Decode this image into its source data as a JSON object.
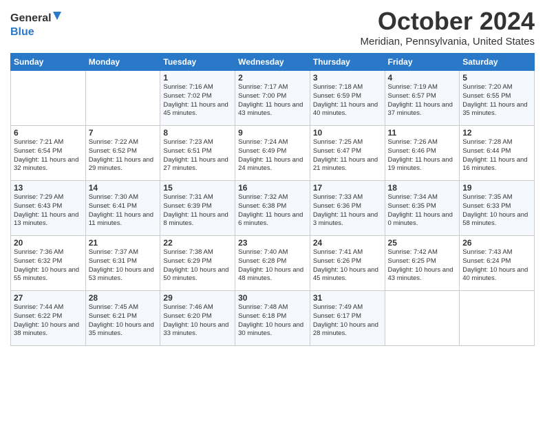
{
  "header": {
    "logo_line1": "General",
    "logo_line2": "Blue",
    "month": "October 2024",
    "location": "Meridian, Pennsylvania, United States"
  },
  "weekdays": [
    "Sunday",
    "Monday",
    "Tuesday",
    "Wednesday",
    "Thursday",
    "Friday",
    "Saturday"
  ],
  "weeks": [
    [
      {
        "day": "",
        "sunrise": "",
        "sunset": "",
        "daylight": ""
      },
      {
        "day": "",
        "sunrise": "",
        "sunset": "",
        "daylight": ""
      },
      {
        "day": "1",
        "sunrise": "Sunrise: 7:16 AM",
        "sunset": "Sunset: 7:02 PM",
        "daylight": "Daylight: 11 hours and 45 minutes."
      },
      {
        "day": "2",
        "sunrise": "Sunrise: 7:17 AM",
        "sunset": "Sunset: 7:00 PM",
        "daylight": "Daylight: 11 hours and 43 minutes."
      },
      {
        "day": "3",
        "sunrise": "Sunrise: 7:18 AM",
        "sunset": "Sunset: 6:59 PM",
        "daylight": "Daylight: 11 hours and 40 minutes."
      },
      {
        "day": "4",
        "sunrise": "Sunrise: 7:19 AM",
        "sunset": "Sunset: 6:57 PM",
        "daylight": "Daylight: 11 hours and 37 minutes."
      },
      {
        "day": "5",
        "sunrise": "Sunrise: 7:20 AM",
        "sunset": "Sunset: 6:55 PM",
        "daylight": "Daylight: 11 hours and 35 minutes."
      }
    ],
    [
      {
        "day": "6",
        "sunrise": "Sunrise: 7:21 AM",
        "sunset": "Sunset: 6:54 PM",
        "daylight": "Daylight: 11 hours and 32 minutes."
      },
      {
        "day": "7",
        "sunrise": "Sunrise: 7:22 AM",
        "sunset": "Sunset: 6:52 PM",
        "daylight": "Daylight: 11 hours and 29 minutes."
      },
      {
        "day": "8",
        "sunrise": "Sunrise: 7:23 AM",
        "sunset": "Sunset: 6:51 PM",
        "daylight": "Daylight: 11 hours and 27 minutes."
      },
      {
        "day": "9",
        "sunrise": "Sunrise: 7:24 AM",
        "sunset": "Sunset: 6:49 PM",
        "daylight": "Daylight: 11 hours and 24 minutes."
      },
      {
        "day": "10",
        "sunrise": "Sunrise: 7:25 AM",
        "sunset": "Sunset: 6:47 PM",
        "daylight": "Daylight: 11 hours and 21 minutes."
      },
      {
        "day": "11",
        "sunrise": "Sunrise: 7:26 AM",
        "sunset": "Sunset: 6:46 PM",
        "daylight": "Daylight: 11 hours and 19 minutes."
      },
      {
        "day": "12",
        "sunrise": "Sunrise: 7:28 AM",
        "sunset": "Sunset: 6:44 PM",
        "daylight": "Daylight: 11 hours and 16 minutes."
      }
    ],
    [
      {
        "day": "13",
        "sunrise": "Sunrise: 7:29 AM",
        "sunset": "Sunset: 6:43 PM",
        "daylight": "Daylight: 11 hours and 13 minutes."
      },
      {
        "day": "14",
        "sunrise": "Sunrise: 7:30 AM",
        "sunset": "Sunset: 6:41 PM",
        "daylight": "Daylight: 11 hours and 11 minutes."
      },
      {
        "day": "15",
        "sunrise": "Sunrise: 7:31 AM",
        "sunset": "Sunset: 6:39 PM",
        "daylight": "Daylight: 11 hours and 8 minutes."
      },
      {
        "day": "16",
        "sunrise": "Sunrise: 7:32 AM",
        "sunset": "Sunset: 6:38 PM",
        "daylight": "Daylight: 11 hours and 6 minutes."
      },
      {
        "day": "17",
        "sunrise": "Sunrise: 7:33 AM",
        "sunset": "Sunset: 6:36 PM",
        "daylight": "Daylight: 11 hours and 3 minutes."
      },
      {
        "day": "18",
        "sunrise": "Sunrise: 7:34 AM",
        "sunset": "Sunset: 6:35 PM",
        "daylight": "Daylight: 11 hours and 0 minutes."
      },
      {
        "day": "19",
        "sunrise": "Sunrise: 7:35 AM",
        "sunset": "Sunset: 6:33 PM",
        "daylight": "Daylight: 10 hours and 58 minutes."
      }
    ],
    [
      {
        "day": "20",
        "sunrise": "Sunrise: 7:36 AM",
        "sunset": "Sunset: 6:32 PM",
        "daylight": "Daylight: 10 hours and 55 minutes."
      },
      {
        "day": "21",
        "sunrise": "Sunrise: 7:37 AM",
        "sunset": "Sunset: 6:31 PM",
        "daylight": "Daylight: 10 hours and 53 minutes."
      },
      {
        "day": "22",
        "sunrise": "Sunrise: 7:38 AM",
        "sunset": "Sunset: 6:29 PM",
        "daylight": "Daylight: 10 hours and 50 minutes."
      },
      {
        "day": "23",
        "sunrise": "Sunrise: 7:40 AM",
        "sunset": "Sunset: 6:28 PM",
        "daylight": "Daylight: 10 hours and 48 minutes."
      },
      {
        "day": "24",
        "sunrise": "Sunrise: 7:41 AM",
        "sunset": "Sunset: 6:26 PM",
        "daylight": "Daylight: 10 hours and 45 minutes."
      },
      {
        "day": "25",
        "sunrise": "Sunrise: 7:42 AM",
        "sunset": "Sunset: 6:25 PM",
        "daylight": "Daylight: 10 hours and 43 minutes."
      },
      {
        "day": "26",
        "sunrise": "Sunrise: 7:43 AM",
        "sunset": "Sunset: 6:24 PM",
        "daylight": "Daylight: 10 hours and 40 minutes."
      }
    ],
    [
      {
        "day": "27",
        "sunrise": "Sunrise: 7:44 AM",
        "sunset": "Sunset: 6:22 PM",
        "daylight": "Daylight: 10 hours and 38 minutes."
      },
      {
        "day": "28",
        "sunrise": "Sunrise: 7:45 AM",
        "sunset": "Sunset: 6:21 PM",
        "daylight": "Daylight: 10 hours and 35 minutes."
      },
      {
        "day": "29",
        "sunrise": "Sunrise: 7:46 AM",
        "sunset": "Sunset: 6:20 PM",
        "daylight": "Daylight: 10 hours and 33 minutes."
      },
      {
        "day": "30",
        "sunrise": "Sunrise: 7:48 AM",
        "sunset": "Sunset: 6:18 PM",
        "daylight": "Daylight: 10 hours and 30 minutes."
      },
      {
        "day": "31",
        "sunrise": "Sunrise: 7:49 AM",
        "sunset": "Sunset: 6:17 PM",
        "daylight": "Daylight: 10 hours and 28 minutes."
      },
      {
        "day": "",
        "sunrise": "",
        "sunset": "",
        "daylight": ""
      },
      {
        "day": "",
        "sunrise": "",
        "sunset": "",
        "daylight": ""
      }
    ]
  ]
}
